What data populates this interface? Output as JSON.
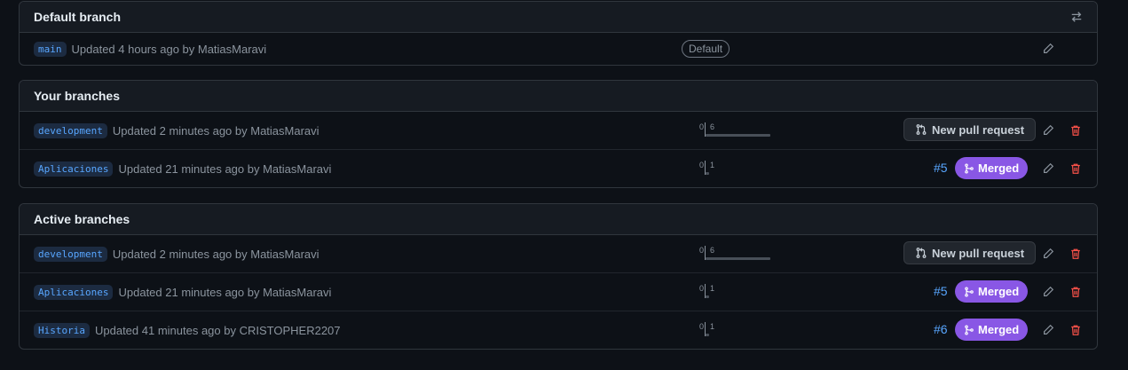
{
  "default_branch": {
    "title": "Default branch",
    "branch": "main",
    "updated": "Updated 4 hours ago by MatiasMaravi",
    "badge": "Default"
  },
  "your_branches": {
    "title": "Your branches",
    "rows": [
      {
        "branch": "development",
        "updated": "Updated 2 minutes ago by MatiasMaravi",
        "behind": "0",
        "ahead": "6",
        "ahead_fraction": 1.0,
        "action": "New pull request"
      },
      {
        "branch": "Aplicaciones",
        "updated": "Updated 21 minutes ago by MatiasMaravi",
        "behind": "0",
        "ahead": "1",
        "ahead_fraction": 0.05,
        "pr": "#5",
        "status": "Merged"
      }
    ]
  },
  "active_branches": {
    "title": "Active branches",
    "rows": [
      {
        "branch": "development",
        "updated": "Updated 2 minutes ago by MatiasMaravi",
        "behind": "0",
        "ahead": "6",
        "ahead_fraction": 1.0,
        "action": "New pull request"
      },
      {
        "branch": "Aplicaciones",
        "updated": "Updated 21 minutes ago by MatiasMaravi",
        "behind": "0",
        "ahead": "1",
        "ahead_fraction": 0.05,
        "pr": "#5",
        "status": "Merged"
      },
      {
        "branch": "Historia",
        "updated": "Updated 41 minutes ago by CRISTOPHER2207",
        "behind": "0",
        "ahead": "1",
        "ahead_fraction": 0.05,
        "pr": "#6",
        "status": "Merged"
      }
    ]
  },
  "colors": {
    "accent": "#58a6ff",
    "merged": "#8957e5",
    "danger": "#f85149"
  },
  "icons": [
    "switch-branch-icon",
    "pencil-icon",
    "trash-icon",
    "pull-request-icon",
    "merge-icon"
  ]
}
